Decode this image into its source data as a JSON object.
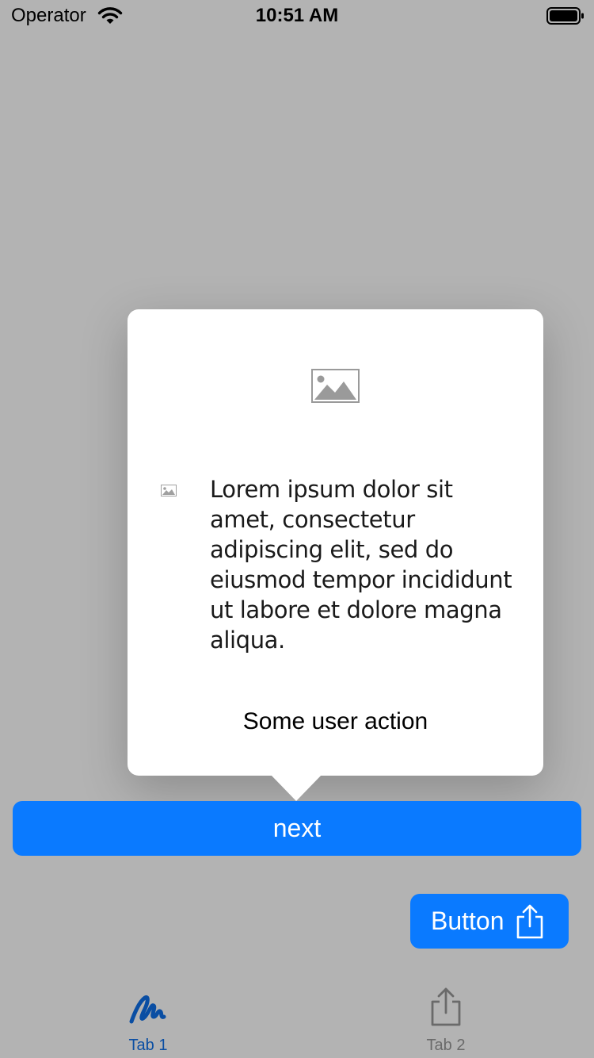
{
  "status_bar": {
    "carrier": "Operator",
    "time": "10:51 AM",
    "wifi_icon": "wifi-icon",
    "battery_icon": "battery-icon"
  },
  "popover": {
    "hero_icon": "image-placeholder-icon",
    "small_icon": "image-placeholder-icon",
    "body": "Lorem ipsum dolor sit amet, consectetur adipiscing elit, sed do eiusmod tempor incididunt ut labore et dolore magna aliqua.",
    "action_label": "Some user action"
  },
  "next_button": {
    "label": "next"
  },
  "share_button": {
    "label": "Button",
    "icon": "share-icon"
  },
  "tab_bar": {
    "tabs": [
      {
        "label": "Tab 1",
        "icon": "scribble-icon",
        "selected": true
      },
      {
        "label": "Tab 2",
        "icon": "share-icon",
        "selected": false
      }
    ]
  },
  "colors": {
    "dim_background": "#b3b3b3",
    "accent": "#0a7aff",
    "tab_selected": "#0a4ea3",
    "tab_unselected": "#6a6a6a"
  }
}
